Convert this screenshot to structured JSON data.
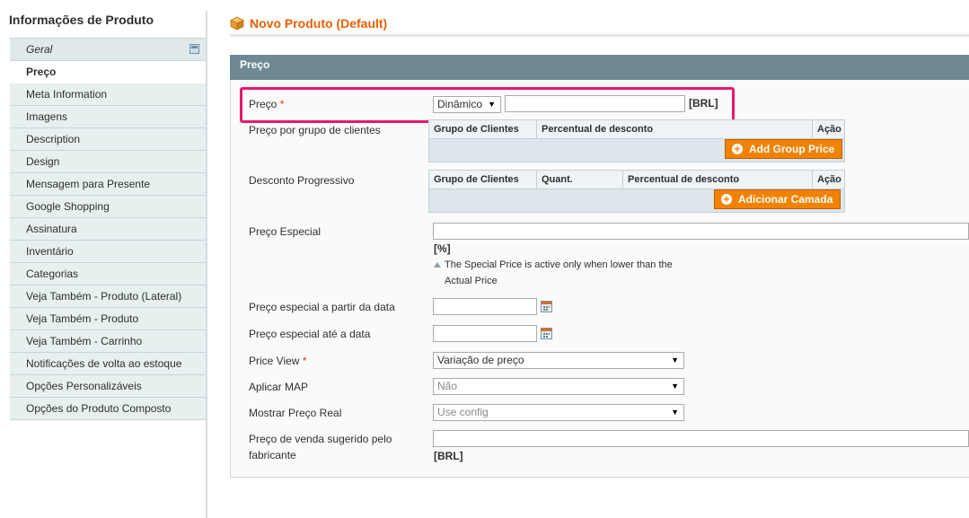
{
  "sidebar": {
    "title": "Informações de Produto",
    "tabs": [
      {
        "label": "Geral"
      },
      {
        "label": "Preço"
      },
      {
        "label": "Meta Information"
      },
      {
        "label": "Imagens"
      },
      {
        "label": "Description"
      },
      {
        "label": "Design"
      },
      {
        "label": "Mensagem para Presente"
      },
      {
        "label": "Google Shopping"
      },
      {
        "label": "Assinatura"
      },
      {
        "label": "Inventário"
      },
      {
        "label": "Categorias"
      },
      {
        "label": "Veja Também - Produto (Lateral)"
      },
      {
        "label": "Veja Também - Produto"
      },
      {
        "label": "Veja Também - Carrinho"
      },
      {
        "label": "Notificações de volta ao estoque"
      },
      {
        "label": "Opções Personalizáveis"
      },
      {
        "label": "Opções do Produto Composto"
      }
    ],
    "active_tab": "Preço"
  },
  "header": {
    "title": "Novo Produto (Default)",
    "icon": "product-cube-icon",
    "title_color": "#eb5e00"
  },
  "fieldset": {
    "title": "Preço",
    "header_color": "#6f8992"
  },
  "price": {
    "label": "Preço",
    "required_mark": "*",
    "type_value": "Dinâmico",
    "value": "",
    "currency": "[BRL]",
    "highlight_color": "#e8186d"
  },
  "group_price": {
    "label": "Preço por grupo de clientes",
    "columns": [
      "Grupo de Clientes",
      "Percentual de desconto",
      "Ação"
    ],
    "button": "Add Group Price"
  },
  "tier_price": {
    "label": "Desconto Progressivo",
    "columns": [
      "Grupo de Clientes",
      "Quant.",
      "Percentual de desconto",
      "Ação"
    ],
    "button": "Adicionar Camada"
  },
  "special_price": {
    "label": "Preço Especial",
    "value": "",
    "unit": "[%]",
    "note_line1": "The Special Price is active only when lower than the",
    "note_line2": "Actual Price"
  },
  "special_from": {
    "label": "Preço especial a partir da data",
    "value": ""
  },
  "special_to": {
    "label": "Preço especial até a data",
    "value": ""
  },
  "price_view": {
    "label": "Price View",
    "required_mark": "*",
    "value": "Variação de preço"
  },
  "apply_map": {
    "label": "Aplicar MAP",
    "value": "Não"
  },
  "msrp_display": {
    "label": "Mostrar Preço Real",
    "value": "Use config"
  },
  "msrp": {
    "label_line1": "Preço de venda sugerido pelo",
    "label_line2": "fabricante",
    "value": "",
    "currency": "[BRL]"
  },
  "accent_color": "#f18200"
}
